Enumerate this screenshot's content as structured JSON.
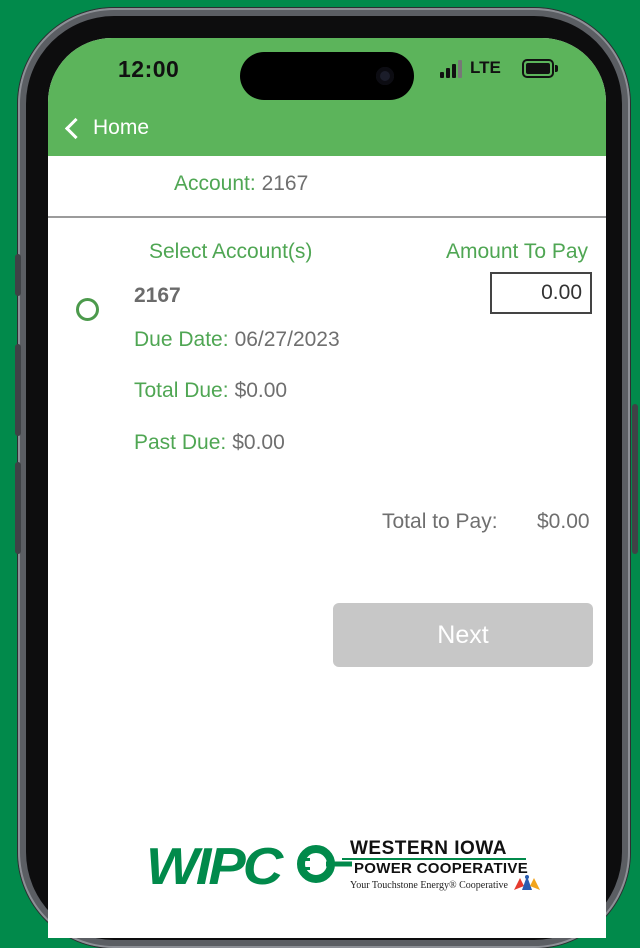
{
  "status_bar": {
    "time": "12:00",
    "network": "LTE",
    "icons": [
      "signal-bars-icon",
      "battery-icon"
    ]
  },
  "nav": {
    "back_label": "Home",
    "back_icon": "chevron-left-icon"
  },
  "account_bar": {
    "label": "Account:",
    "value": "2167"
  },
  "columns": {
    "select": "Select Account(s)",
    "amount": "Amount To Pay"
  },
  "account_row": {
    "number": "2167",
    "amount_value": "0.00",
    "due_date_label": "Due Date:",
    "due_date_value": "06/27/2023",
    "total_due_label": "Total Due:",
    "total_due_value": "$0.00",
    "past_due_label": "Past Due:",
    "past_due_value": "$0.00"
  },
  "summary": {
    "total_label": "Total to Pay:",
    "total_value": "$0.00"
  },
  "actions": {
    "next_label": "Next"
  },
  "logo": {
    "letters": "WIPC",
    "name_line1": "WESTERN IOWA",
    "name_line2": "POWER COOPERATIVE",
    "tagline": "Your Touchstone Energy® Cooperative"
  },
  "colors": {
    "background": "#018a4b",
    "header": "#5cb45b",
    "label_green": "#4fa653",
    "value_gray": "#6f6f6f",
    "button_disabled": "#c7c7c7"
  }
}
